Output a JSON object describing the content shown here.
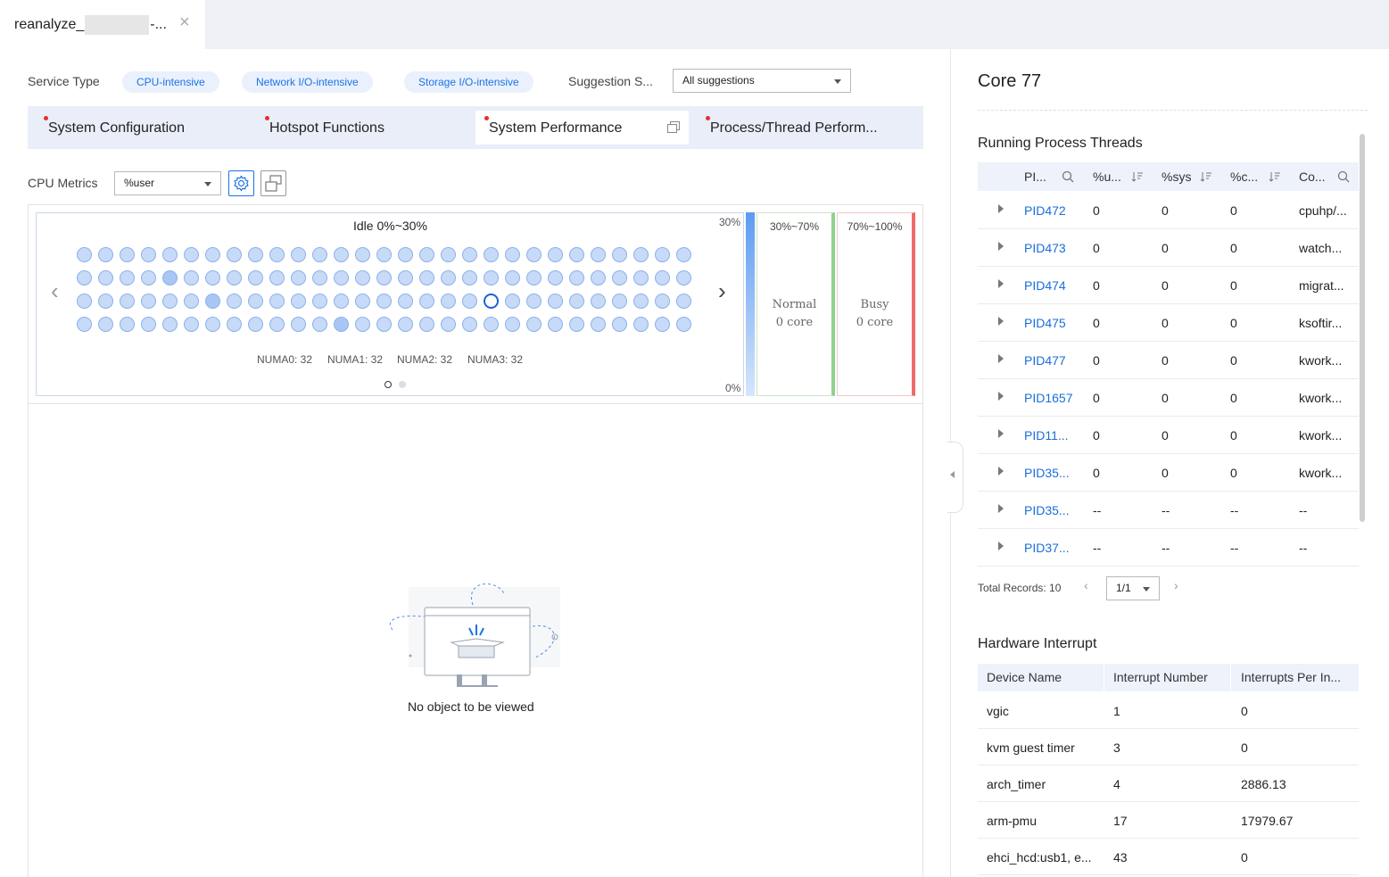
{
  "window": {
    "tab_title_prefix": "reanalyze_",
    "tab_title_suffix": "-...",
    "close_glyph": "×"
  },
  "filters": {
    "service_type_label": "Service Type",
    "service_types": [
      "CPU-intensive",
      "Network I/O-intensive",
      "Storage I/O-intensive"
    ],
    "suggestion_label": "Suggestion S...",
    "suggestion_value": "All suggestions"
  },
  "subtabs": [
    {
      "label": "System Configuration",
      "active": false
    },
    {
      "label": "Hotspot Functions",
      "active": false
    },
    {
      "label": "System Performance",
      "active": true
    },
    {
      "label": "Process/Thread Perform...",
      "active": false
    }
  ],
  "cpu_metrics": {
    "label": "CPU Metrics",
    "value": "%user",
    "settings_icon": "gear-icon",
    "view_icon": "switch-view-icon"
  },
  "heatmap": {
    "title": "Idle 0%~30%",
    "rows": 4,
    "cols": 29,
    "selected_core": {
      "row": 2,
      "col": 19
    },
    "darker_cores": [
      {
        "row": 1,
        "col": 4
      },
      {
        "row": 2,
        "col": 6
      },
      {
        "row": 3,
        "col": 12
      }
    ],
    "numa": [
      "NUMA0: 32",
      "NUMA1: 32",
      "NUMA2: 32",
      "NUMA3: 32"
    ],
    "pages": 2,
    "current_page": 1,
    "scale_top": "30%",
    "scale_bottom": "0%"
  },
  "buckets": [
    {
      "range": "30%~70%",
      "name": "Normal",
      "count": "0 core",
      "color": "#8fd18f"
    },
    {
      "range": "70%~100%",
      "name": "Busy",
      "count": "0 core",
      "color": "#ef6b6b"
    }
  ],
  "empty_state": {
    "text": "No object to be viewed"
  },
  "core": {
    "title": "Core 77"
  },
  "threads": {
    "title": "Running Process Threads",
    "columns": [
      "PI...",
      "%u...",
      "%sys",
      "%c...",
      "Co..."
    ],
    "rows": [
      [
        "PID472",
        "0",
        "0",
        "0",
        "cpuhp/..."
      ],
      [
        "PID473",
        "0",
        "0",
        "0",
        "watch..."
      ],
      [
        "PID474",
        "0",
        "0",
        "0",
        "migrat..."
      ],
      [
        "PID475",
        "0",
        "0",
        "0",
        "ksoftir..."
      ],
      [
        "PID477",
        "0",
        "0",
        "0",
        "kwork..."
      ],
      [
        "PID1657",
        "0",
        "0",
        "0",
        "kwork..."
      ],
      [
        "PID11...",
        "0",
        "0",
        "0",
        "kwork..."
      ],
      [
        "PID35...",
        "0",
        "0",
        "0",
        "kwork..."
      ],
      [
        "PID35...",
        "--",
        "--",
        "--",
        "--"
      ],
      [
        "PID37...",
        "--",
        "--",
        "--",
        "--"
      ]
    ],
    "total_records": "Total Records: 10",
    "page": "1/1"
  },
  "interrupts": {
    "title": "Hardware Interrupt",
    "columns": [
      "Device Name",
      "Interrupt Number",
      "Interrupts Per In..."
    ],
    "rows": [
      [
        "vgic",
        "1",
        "0"
      ],
      [
        "kvm guest timer",
        "3",
        "0"
      ],
      [
        "arch_timer",
        "4",
        "2886.13"
      ],
      [
        "arm-pmu",
        "17",
        "17979.67"
      ],
      [
        "ehci_hcd:usb1, e...",
        "43",
        "0"
      ]
    ]
  },
  "colors": {
    "accent": "#1a73e8",
    "chip_bg": "#eaf1fd",
    "normal": "#8fd18f",
    "busy": "#ef6b6b",
    "red_dot": "#e52e2e"
  }
}
